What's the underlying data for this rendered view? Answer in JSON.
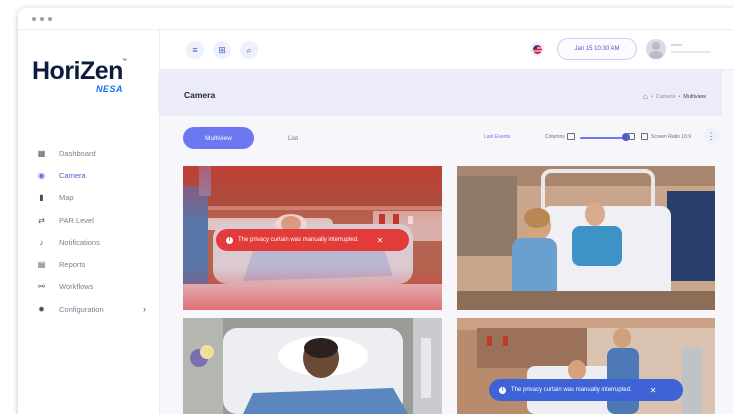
{
  "brand": {
    "name": "HoriZen",
    "sub": "NESA",
    "tm": "™"
  },
  "sidebar": {
    "items": [
      {
        "label": "Dashboard",
        "icon": "dashboard-icon",
        "glyph": "▦",
        "active": false
      },
      {
        "label": "Camera",
        "icon": "camera-icon",
        "glyph": "◉",
        "active": true
      },
      {
        "label": "Map",
        "icon": "map-icon",
        "glyph": "▮",
        "active": false
      },
      {
        "label": "PAR Level",
        "icon": "par-level-icon",
        "glyph": "⇄",
        "active": false
      },
      {
        "label": "Notifications",
        "icon": "bell-icon",
        "glyph": "♪",
        "active": false
      },
      {
        "label": "Reports",
        "icon": "reports-icon",
        "glyph": "▤",
        "active": false
      },
      {
        "label": "Workflows",
        "icon": "workflows-icon",
        "glyph": "⚯",
        "active": false
      },
      {
        "label": "Configuration",
        "icon": "gear-icon",
        "glyph": "✹",
        "active": false,
        "chevron": "›"
      }
    ]
  },
  "topbar": {
    "menu_glyph": "≡",
    "grid_glyph": "⊞",
    "search_glyph": "⌕",
    "date": "Jan 15 10:30 AM",
    "user_name": "Admin"
  },
  "page": {
    "title": "Camera",
    "breadcrumb": [
      "Camera",
      "Multiview"
    ],
    "breadcrumb_sep": "•",
    "home_glyph": "⌂"
  },
  "toolbar": {
    "tabs": [
      {
        "label": "Multiview",
        "active": true
      },
      {
        "label": "List",
        "active": false
      }
    ],
    "last_events": "Last Events",
    "columns_label": "Columns",
    "columns_value": 0.85,
    "ratio_label": "Screen Ratio 16:9",
    "more_glyph": "⋮"
  },
  "alerts": [
    {
      "text": "The privacy curtain was manually interrupted.",
      "info": "i",
      "close": "✕",
      "color": "#e33a3a"
    },
    {
      "text": "The privacy curtain was manually interrupted.",
      "info": "i",
      "close": "✕",
      "color": "#3d63d6"
    }
  ],
  "colors": {
    "accent": "#6b78f2",
    "alert_red": "#e33a3a",
    "alert_blue": "#3d63d6"
  }
}
